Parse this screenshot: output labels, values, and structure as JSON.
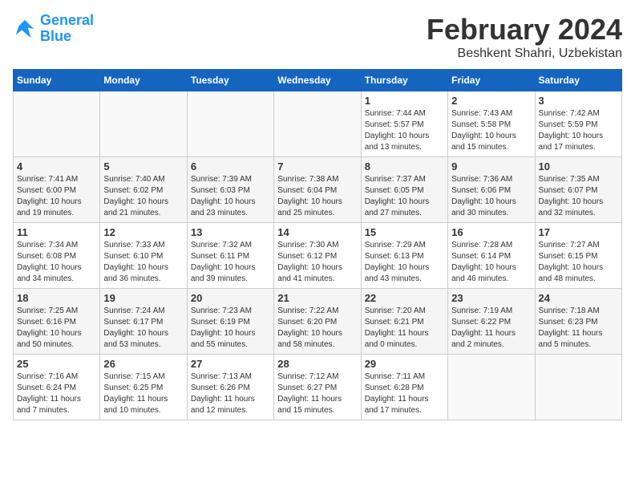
{
  "header": {
    "logo_line1": "General",
    "logo_line2": "Blue",
    "month": "February 2024",
    "location": "Beshkent Shahri, Uzbekistan"
  },
  "days_of_week": [
    "Sunday",
    "Monday",
    "Tuesday",
    "Wednesday",
    "Thursday",
    "Friday",
    "Saturday"
  ],
  "weeks": [
    [
      {
        "day": "",
        "info": ""
      },
      {
        "day": "",
        "info": ""
      },
      {
        "day": "",
        "info": ""
      },
      {
        "day": "",
        "info": ""
      },
      {
        "day": "1",
        "info": "Sunrise: 7:44 AM\nSunset: 5:57 PM\nDaylight: 10 hours\nand 13 minutes."
      },
      {
        "day": "2",
        "info": "Sunrise: 7:43 AM\nSunset: 5:58 PM\nDaylight: 10 hours\nand 15 minutes."
      },
      {
        "day": "3",
        "info": "Sunrise: 7:42 AM\nSunset: 5:59 PM\nDaylight: 10 hours\nand 17 minutes."
      }
    ],
    [
      {
        "day": "4",
        "info": "Sunrise: 7:41 AM\nSunset: 6:00 PM\nDaylight: 10 hours\nand 19 minutes."
      },
      {
        "day": "5",
        "info": "Sunrise: 7:40 AM\nSunset: 6:02 PM\nDaylight: 10 hours\nand 21 minutes."
      },
      {
        "day": "6",
        "info": "Sunrise: 7:39 AM\nSunset: 6:03 PM\nDaylight: 10 hours\nand 23 minutes."
      },
      {
        "day": "7",
        "info": "Sunrise: 7:38 AM\nSunset: 6:04 PM\nDaylight: 10 hours\nand 25 minutes."
      },
      {
        "day": "8",
        "info": "Sunrise: 7:37 AM\nSunset: 6:05 PM\nDaylight: 10 hours\nand 27 minutes."
      },
      {
        "day": "9",
        "info": "Sunrise: 7:36 AM\nSunset: 6:06 PM\nDaylight: 10 hours\nand 30 minutes."
      },
      {
        "day": "10",
        "info": "Sunrise: 7:35 AM\nSunset: 6:07 PM\nDaylight: 10 hours\nand 32 minutes."
      }
    ],
    [
      {
        "day": "11",
        "info": "Sunrise: 7:34 AM\nSunset: 6:08 PM\nDaylight: 10 hours\nand 34 minutes."
      },
      {
        "day": "12",
        "info": "Sunrise: 7:33 AM\nSunset: 6:10 PM\nDaylight: 10 hours\nand 36 minutes."
      },
      {
        "day": "13",
        "info": "Sunrise: 7:32 AM\nSunset: 6:11 PM\nDaylight: 10 hours\nand 39 minutes."
      },
      {
        "day": "14",
        "info": "Sunrise: 7:30 AM\nSunset: 6:12 PM\nDaylight: 10 hours\nand 41 minutes."
      },
      {
        "day": "15",
        "info": "Sunrise: 7:29 AM\nSunset: 6:13 PM\nDaylight: 10 hours\nand 43 minutes."
      },
      {
        "day": "16",
        "info": "Sunrise: 7:28 AM\nSunset: 6:14 PM\nDaylight: 10 hours\nand 46 minutes."
      },
      {
        "day": "17",
        "info": "Sunrise: 7:27 AM\nSunset: 6:15 PM\nDaylight: 10 hours\nand 48 minutes."
      }
    ],
    [
      {
        "day": "18",
        "info": "Sunrise: 7:25 AM\nSunset: 6:16 PM\nDaylight: 10 hours\nand 50 minutes."
      },
      {
        "day": "19",
        "info": "Sunrise: 7:24 AM\nSunset: 6:17 PM\nDaylight: 10 hours\nand 53 minutes."
      },
      {
        "day": "20",
        "info": "Sunrise: 7:23 AM\nSunset: 6:19 PM\nDaylight: 10 hours\nand 55 minutes."
      },
      {
        "day": "21",
        "info": "Sunrise: 7:22 AM\nSunset: 6:20 PM\nDaylight: 10 hours\nand 58 minutes."
      },
      {
        "day": "22",
        "info": "Sunrise: 7:20 AM\nSunset: 6:21 PM\nDaylight: 11 hours\nand 0 minutes."
      },
      {
        "day": "23",
        "info": "Sunrise: 7:19 AM\nSunset: 6:22 PM\nDaylight: 11 hours\nand 2 minutes."
      },
      {
        "day": "24",
        "info": "Sunrise: 7:18 AM\nSunset: 6:23 PM\nDaylight: 11 hours\nand 5 minutes."
      }
    ],
    [
      {
        "day": "25",
        "info": "Sunrise: 7:16 AM\nSunset: 6:24 PM\nDaylight: 11 hours\nand 7 minutes."
      },
      {
        "day": "26",
        "info": "Sunrise: 7:15 AM\nSunset: 6:25 PM\nDaylight: 11 hours\nand 10 minutes."
      },
      {
        "day": "27",
        "info": "Sunrise: 7:13 AM\nSunset: 6:26 PM\nDaylight: 11 hours\nand 12 minutes."
      },
      {
        "day": "28",
        "info": "Sunrise: 7:12 AM\nSunset: 6:27 PM\nDaylight: 11 hours\nand 15 minutes."
      },
      {
        "day": "29",
        "info": "Sunrise: 7:11 AM\nSunset: 6:28 PM\nDaylight: 11 hours\nand 17 minutes."
      },
      {
        "day": "",
        "info": ""
      },
      {
        "day": "",
        "info": ""
      }
    ]
  ]
}
